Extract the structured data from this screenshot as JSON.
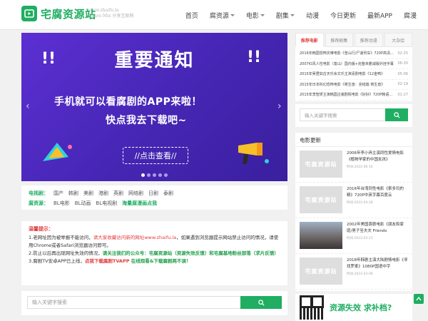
{
  "header": {
    "logo_text": "宅腐资源站",
    "logo_sub_line1": "www.zhaifu.la",
    "logo_sub_line2": "Share-Mix 分享互联网",
    "nav": [
      {
        "label": "首页",
        "dropdown": false
      },
      {
        "label": "腐资源",
        "dropdown": true
      },
      {
        "label": "电影",
        "dropdown": true
      },
      {
        "label": "剧集",
        "dropdown": true
      },
      {
        "label": "动漫",
        "dropdown": false
      },
      {
        "label": "今日更新",
        "dropdown": false
      },
      {
        "label": "最新APP",
        "dropdown": false
      },
      {
        "label": "腐漫",
        "dropdown": false
      }
    ]
  },
  "banner": {
    "title": "重要通知",
    "line1": "手机就可以看腐剧的APP来啦！",
    "line2": "快点我去下载吧~",
    "button": "//点击查看//",
    "slides": 5,
    "active_slide": 1,
    "prev_icon": "chevron-left-icon",
    "next_icon": "chevron-right-icon"
  },
  "categories": {
    "row1_label": "电视剧：",
    "row1": [
      "国产",
      "韩剧",
      "美剧",
      "港剧",
      "英剧",
      "网络剧",
      "日剧",
      "泰剧"
    ],
    "row2_label": "腐资源：",
    "row2": [
      "BL电影",
      "BL动画",
      "BL电视剧"
    ],
    "row2_highlight": "海量腐漫画点我"
  },
  "notice": {
    "title": "温馨提示：",
    "p1_a": "1.老网址因为被举报不能访问，",
    "p1_b": "请大家收藏访问新的网址www.zhaifu.la",
    "p1_c": "，如果遇到浏览器提示网站禁止访问的情况，请使用Chrome或者Safari浏览器访问即可。",
    "p2_a": "2.防止以后再出现网址失效的情况，",
    "p2_b": "请关注我们的公众号：宅腐资源站（资源失效反馈）和宅腐基地粉丝部落（求片反馈）",
    "p3_a": "3.腐剧TV安卓APP已上线，",
    "p3_b": "点我下载腐剧TVAPP",
    "p3_c": " 在线观看&下载腐剧两不误！"
  },
  "search": {
    "placeholder": "输入关键字搜索"
  },
  "sidebar": {
    "tabs": [
      "推荐电影",
      "推荐剧集",
      "推荐动漫",
      "大杂烩"
    ],
    "active_tab": 0,
    "news": [
      {
        "title": "2016年韩国恐怖灾难电影《釜山行/尸速列车》720P高清中字",
        "date": "02-25"
      },
      {
        "title": "2007红风人性电影（富山）国内版+完整未删减版外挂字幕",
        "date": "06-30"
      },
      {
        "title": "2015年吴君如古天乐余文乐主演喜剧电影《12金鸭》",
        "date": "05-06"
      },
      {
        "title": "2015年日本科幻恐怖电影《寄生兽：完结篇 寄生兽》",
        "date": "02-19"
      },
      {
        "title": "2015年李智妍主演韩国古装剧情电影《好好》720P韩语中字",
        "date": "01-27"
      }
    ],
    "search_placeholder": "输入关键字搜索",
    "movie_head": "电影更新",
    "movies": [
      {
        "title": "2006年李小冉主演同性爱情电影《植物学家的中国女孩》",
        "date": "时间:2022-06-16",
        "thumb": "宅腐资源站",
        "photo": false
      },
      {
        "title": "2016年台湾同性电影《索多玛的精》720P中英字幕百度云",
        "date": "时间:2022-04-28",
        "thumb": "宅腐资源站",
        "photo": false
      },
      {
        "title": "2002年美国喜剧电影《朋友和家庭/男子至夫夫 Friends",
        "date": "时间:2022-03-21",
        "thumb": "",
        "photo": true
      },
      {
        "title": "2018年韩剧主演大陆剧情电影《寻找罗麦》1080P国语中字",
        "date": "时间:2022-03-09",
        "thumb": "宅腐资源站",
        "photo": false
      }
    ],
    "qr_text": "资源失效 求补档?"
  }
}
